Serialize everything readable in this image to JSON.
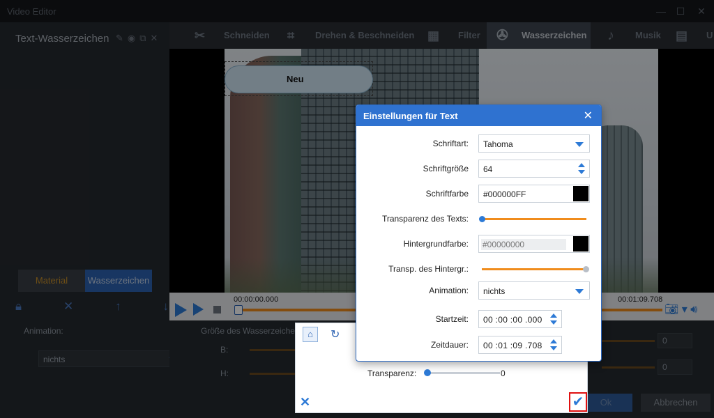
{
  "window": {
    "title": "Video Editor",
    "minimize": "—",
    "maximize": "☐",
    "close": "✕"
  },
  "left_panel": {
    "title": "Text-Wasserzeichen",
    "tabs": [
      "Material",
      "Wasserzeichen"
    ],
    "animation_label": "Animation:",
    "animation_value": "nichts"
  },
  "top_tabs": [
    {
      "label": "Schneiden",
      "icon": "scissors-icon"
    },
    {
      "label": "Drehen & Beschneiden",
      "icon": "crop-icon"
    },
    {
      "label": "Filter",
      "icon": "filter-icon"
    },
    {
      "label": "Wasserzeichen",
      "icon": "film-reel-icon",
      "active": true
    },
    {
      "label": "Musik",
      "icon": "music-note-icon"
    },
    {
      "label": "U",
      "icon": "subtitle-icon"
    }
  ],
  "preview": {
    "watermark_text": "Neu"
  },
  "timeline": {
    "start": "00:00:00.000",
    "end": "00:01:09.708"
  },
  "lower": {
    "size_label": "Größe des Wasserzeichen",
    "b_label": "B:",
    "h_label": "H:",
    "right_val1": "0",
    "right_val2": "0",
    "ok": "Ok",
    "cancel": "Abbrechen"
  },
  "white_panel": {
    "transparency_label": "Transparenz:",
    "transparency_value": "0"
  },
  "dialog": {
    "title": "Einstellungen für Text",
    "font_label": "Schriftart:",
    "font_value": "Tahoma",
    "size_label": "Schriftgröße",
    "size_value": "64",
    "color_label": "Schriftfarbe",
    "color_value": "#000000FF",
    "text_transparency_label": "Transparenz des Texts:",
    "text_transparency_value": 0,
    "bg_color_label": "Hintergrundfarbe:",
    "bg_color_value": "#00000000",
    "bg_transparency_label": "Transp. des Hintergr.:",
    "bg_transparency_value": 1,
    "animation_label": "Animation:",
    "animation_value": "nichts",
    "start_label": "Startzeit:",
    "start_value": "00 :00 :00 .000",
    "duration_label": "Zeitdauer:",
    "duration_value": "00 :01 :09 .708"
  },
  "colors": {
    "accent": "#2f72d0",
    "slider": "#f08c1c",
    "confirm_highlight": "#e01010"
  }
}
